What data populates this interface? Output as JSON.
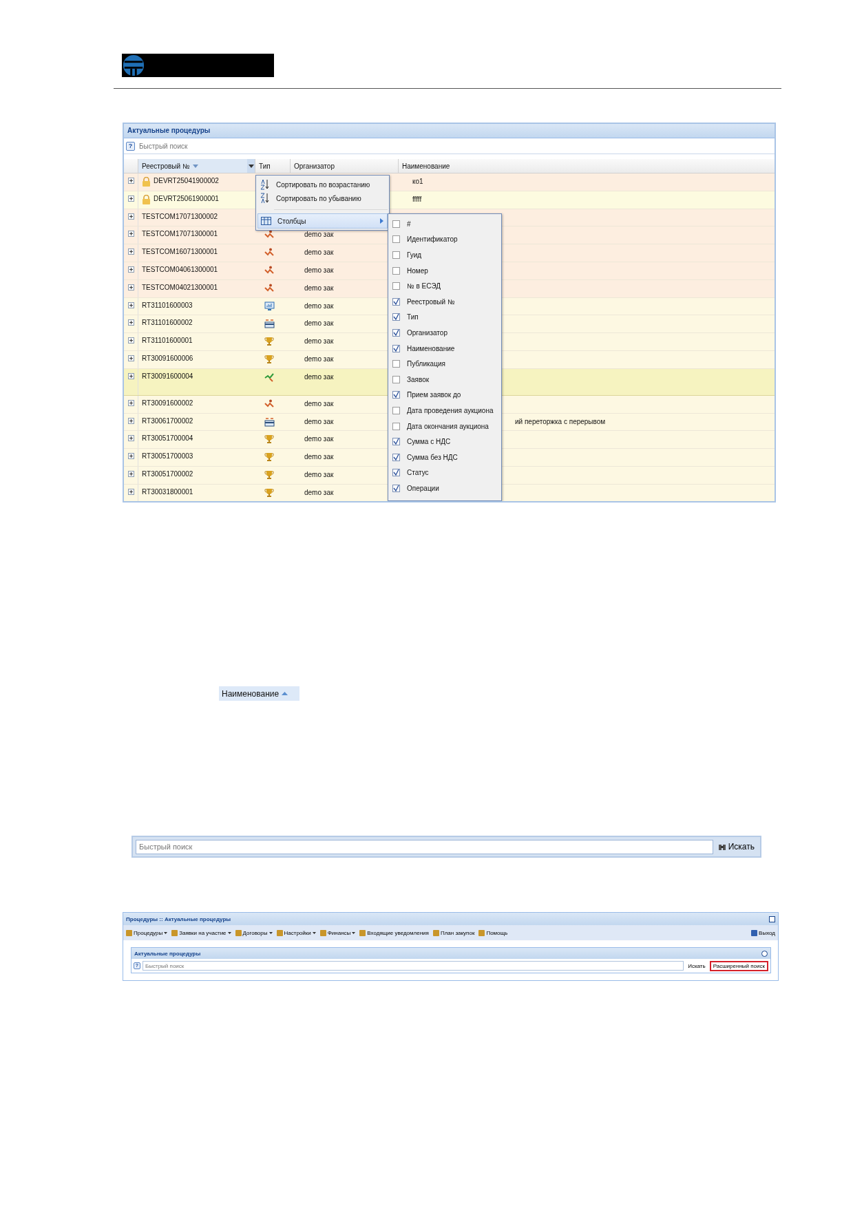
{
  "grid": {
    "title": "Актуальные процедуры",
    "help_label": "?",
    "search_placeholder": "Быстрый поиск",
    "columns": [
      {
        "label": "Реестровый №",
        "sort_descending": true,
        "menu_trigger": true
      },
      {
        "label": "Тип",
        "sort_descending": false,
        "menu_trigger": false
      },
      {
        "label": "Организатор",
        "sort_descending": false,
        "menu_trigger": false
      },
      {
        "label": "Наименование",
        "sort_descending": false,
        "menu_trigger": false
      }
    ],
    "rows": [
      {
        "registry_no": "DEVRT25041900002",
        "locked": true,
        "name": "ко1",
        "color": "#fdeee0",
        "selected": false
      },
      {
        "registry_no": "DEVRT25061900001",
        "locked": true,
        "name": "fffff",
        "color": "#fdfbe0",
        "selected": false
      },
      {
        "registry_no": "TESTCOM17071300002",
        "locked": false,
        "color": "#fdeee0",
        "selected": false
      },
      {
        "registry_no": "TESTCOM17071300001",
        "locked": false,
        "kind": "rebid",
        "organizer": "demo зак",
        "color": "#fdeee0",
        "selected": false
      },
      {
        "registry_no": "TESTCOM16071300001",
        "locked": false,
        "kind": "rebid",
        "organizer": "demo зак",
        "color": "#fdeee0",
        "selected": false
      },
      {
        "registry_no": "TESTCOM04061300001",
        "locked": false,
        "kind": "rebid",
        "organizer": "demo зак",
        "color": "#fdeee0",
        "selected": false
      },
      {
        "registry_no": "TESTCOM04021300001",
        "locked": false,
        "kind": "rebid",
        "organizer": "demo зак",
        "color": "#fdeee0",
        "selected": false
      },
      {
        "registry_no": "RT31101600003",
        "locked": false,
        "kind": "monitor",
        "organizer": "demo зак",
        "color": "#fdf8e2",
        "selected": false
      },
      {
        "registry_no": "RT31101600002",
        "locked": false,
        "kind": "tray",
        "organizer": "demo зак",
        "color": "#fdf8e2",
        "selected": false
      },
      {
        "registry_no": "RT31101600001",
        "locked": false,
        "kind": "trophy",
        "organizer": "demo зак",
        "color": "#fdf8e2",
        "selected": false
      },
      {
        "registry_no": "RT30091600006",
        "locked": false,
        "kind": "trophy",
        "organizer": "demo зак",
        "color": "#fdf8e2",
        "selected": false
      },
      {
        "registry_no": "RT30091600004",
        "locked": false,
        "kind": "trend",
        "organizer": "demo зак",
        "color": "#f6f3c0",
        "selected": true
      },
      {
        "registry_no": "RT30091600002",
        "locked": false,
        "kind": "rebid",
        "organizer": "demo зак",
        "color": "#fdf8e2",
        "selected": false
      },
      {
        "registry_no": "RT30061700002",
        "locked": false,
        "kind": "tray",
        "organizer": "demo зак",
        "name": "ий переторжка с перерывом",
        "color": "#fdf8e2",
        "selected": false
      },
      {
        "registry_no": "RT30051700004",
        "locked": false,
        "kind": "trophy",
        "organizer": "demo зак",
        "color": "#fdf8e2",
        "selected": false
      },
      {
        "registry_no": "RT30051700003",
        "locked": false,
        "kind": "trophy",
        "organizer": "demo зак",
        "color": "#fdf8e2",
        "selected": false
      },
      {
        "registry_no": "RT30051700002",
        "locked": false,
        "kind": "trophy",
        "organizer": "demo зак",
        "color": "#fdf8e2",
        "selected": false
      },
      {
        "registry_no": "RT30031800001",
        "locked": false,
        "kind": "trophy",
        "organizer": "demo зак",
        "color": "#fdf8e2",
        "selected": false
      }
    ],
    "column_menu": {
      "items": [
        {
          "kind": "sort_asc",
          "label": "Сортировать по возрастанию",
          "selected": false
        },
        {
          "kind": "sort_desc",
          "label": "Сортировать по убыванию",
          "selected": false
        },
        {
          "kind": "columns",
          "label": "Столбцы",
          "selected": true
        }
      ],
      "submenu": [
        {
          "label": "#",
          "checked": false
        },
        {
          "label": "Идентификатор",
          "checked": false
        },
        {
          "label": "Гуид",
          "checked": false
        },
        {
          "label": "Номер",
          "checked": false
        },
        {
          "label": "№ в ЕСЭД",
          "checked": false
        },
        {
          "label": "Реестровый №",
          "checked": true
        },
        {
          "label": "Тип",
          "checked": true
        },
        {
          "label": "Организатор",
          "checked": true
        },
        {
          "label": "Наименование",
          "checked": true
        },
        {
          "label": "Публикация",
          "checked": false
        },
        {
          "label": "Заявок",
          "checked": false
        },
        {
          "label": "Прием заявок до",
          "checked": true
        },
        {
          "label": "Дата проведения аукциона",
          "checked": false
        },
        {
          "label": "Дата окончания аукциона",
          "checked": false
        },
        {
          "label": "Сумма с НДС",
          "checked": true
        },
        {
          "label": "Сумма без НДС",
          "checked": true
        },
        {
          "label": "Статус",
          "checked": true
        },
        {
          "label": "Операции",
          "checked": true
        }
      ]
    }
  },
  "sort_header": {
    "label": "Наименование",
    "sort_ascending": true
  },
  "search_bar": {
    "placeholder": "Быстрый поиск",
    "button": "Искать"
  },
  "app_window": {
    "title": "Процедуры :: Актуальные процедуры",
    "toolbar": [
      {
        "label": "Процедуры",
        "dropdown": true
      },
      {
        "label": "Заявки на участие",
        "dropdown": true
      },
      {
        "label": "Договоры",
        "dropdown": true
      },
      {
        "label": "Настройки",
        "dropdown": true
      },
      {
        "label": "Финансы",
        "dropdown": true
      },
      {
        "label": "Входящие уведомления",
        "dropdown": false
      },
      {
        "label": "План закупок",
        "dropdown": false
      },
      {
        "label": "Помощь",
        "dropdown": false
      }
    ],
    "exit": "Выход",
    "panel_title": "Актуальные процедуры",
    "help_label": "?",
    "search_placeholder": "Быстрый поиск",
    "search_button": "Искать",
    "advanced_search": {
      "label": "Расширенный поиск",
      "highlighted": true
    }
  }
}
